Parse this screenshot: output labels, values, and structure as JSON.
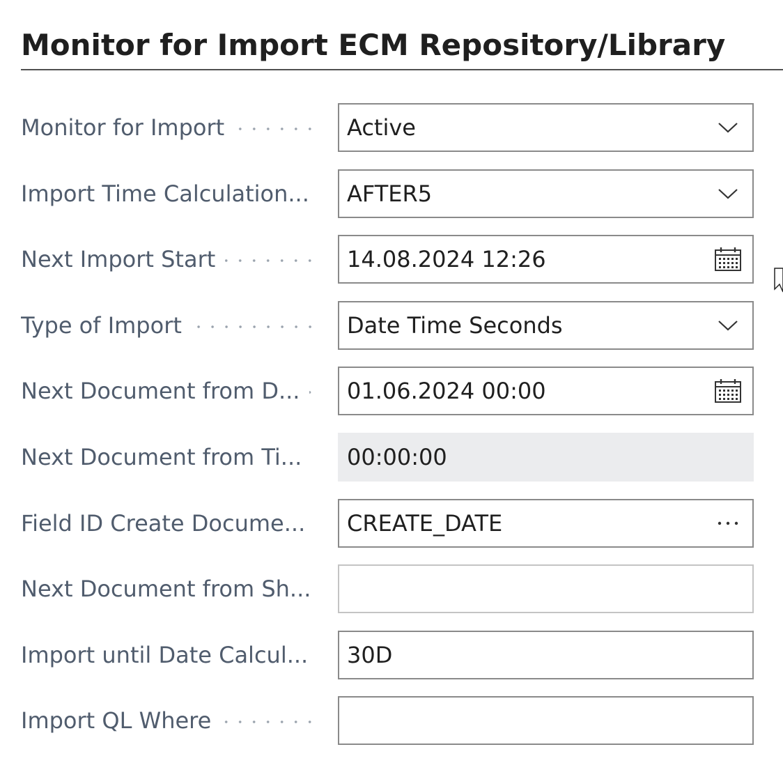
{
  "section": {
    "title": "Monitor for Import ECM Repository/Library"
  },
  "fields": [
    {
      "label": "Monitor for Import",
      "value": "Active",
      "control": "dropdown",
      "icon": "chevron-down-icon"
    },
    {
      "label": "Import Time Calculation...",
      "value": "AFTER5",
      "control": "dropdown",
      "icon": "chevron-down-icon"
    },
    {
      "label": "Next Import Start",
      "value": "14.08.2024 12:26",
      "control": "datetime",
      "icon": "calendar-icon"
    },
    {
      "label": "Type of Import",
      "value": "Date Time Seconds",
      "control": "dropdown",
      "icon": "chevron-down-icon"
    },
    {
      "label": "Next Document from D...",
      "value": "01.06.2024 00:00",
      "control": "datetime",
      "icon": "calendar-icon"
    },
    {
      "label": "Next Document from Ti...",
      "value": "00:00:00",
      "control": "readonly"
    },
    {
      "label": "Field ID Create Docume...",
      "value": "CREATE_DATE",
      "control": "lookup",
      "icon": "more-options-icon"
    },
    {
      "label": "Next Document from Sh...",
      "value": "",
      "control": "text-disabled"
    },
    {
      "label": "Import until Date Calcul...",
      "value": "30D",
      "control": "text"
    },
    {
      "label": "Import QL Where",
      "value": "",
      "control": "text"
    }
  ],
  "colors": {
    "label": "#505c6d",
    "value": "#1f1f1f",
    "border": "#8a8a8a",
    "readonly_bg": "#ebecee"
  }
}
